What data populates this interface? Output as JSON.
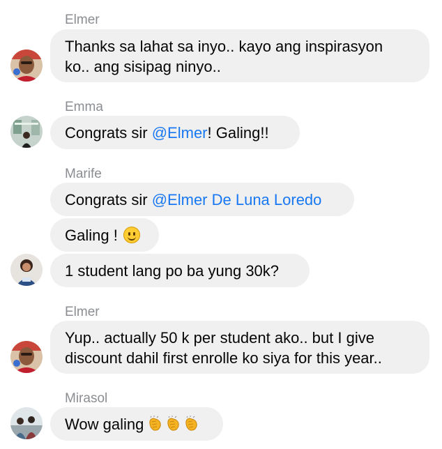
{
  "messages": [
    {
      "sender": "Elmer",
      "bubbles": [
        {
          "lines": [
            "Thanks sa lahat sa inyo.. kayo ang inspirasyon",
            "ko.. ang sisipag ninyo.."
          ]
        }
      ]
    },
    {
      "sender": "Emma",
      "bubbles": [
        {
          "prefix": "Congrats sir ",
          "mention": "@Elmer",
          "suffix": "! Galing!!"
        }
      ]
    },
    {
      "sender": "Marife",
      "bubbles": [
        {
          "prefix": "Congrats sir ",
          "mention": "@Elmer De Luna Loredo"
        },
        {
          "text": "Galing !"
        },
        {
          "text": "1 student lang po ba yung 30k?"
        }
      ]
    },
    {
      "sender": "Elmer",
      "bubbles": [
        {
          "lines": [
            "Yup.. actually 50 k per student ako.. but I give",
            "discount dahil first enrolle ko siya for this year.."
          ]
        }
      ]
    },
    {
      "sender": "Mirasol",
      "bubbles": [
        {
          "text": "Wow galing"
        }
      ]
    }
  ],
  "icons": {
    "smile": "slightly-smiling-face-icon",
    "clap": "clapping-hands-icon"
  },
  "colors": {
    "bubble": "#f0f0f0",
    "mention": "#1877f2",
    "sender": "#8a8d91",
    "text": "#050505"
  }
}
